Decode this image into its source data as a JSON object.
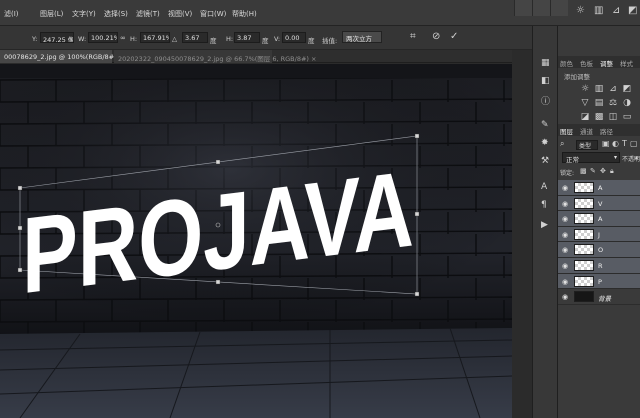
{
  "menu": {
    "items": [
      "滤(I)",
      "图层(L)",
      "文字(Y)",
      "选择(S)",
      "滤镜(T)",
      "视图(V)",
      "窗口(W)",
      "帮助(H)"
    ]
  },
  "options": {
    "y_label": "Y:",
    "y_value": "247.25 像3",
    "w_label": "W:",
    "w_value": "100.21%",
    "h_label": "H:",
    "h_value": "167.91%",
    "angle_label": "△",
    "angle_value": "3.67",
    "angle_unit": "度",
    "hskew_label": "H:",
    "hskew_value": "3.87",
    "hskew_unit": "度",
    "vskew_label": "V:",
    "vskew_value": "0.00",
    "vskew_unit": "度",
    "interp_label": "插值:",
    "interp_value": "两次立方",
    "cancel_icon": "⊘",
    "commit_icon": "✓"
  },
  "tabs": {
    "active": "00078629_2.jpg @ 100%(RGB/8#) ×",
    "inactive": "20202322_090450078629_2.jpg @ 66.7%(图层 6, RGB/8#) ×"
  },
  "canvas": {
    "text": "PROJAVA",
    "text_color": "#ffffff",
    "wall_color": "#1a1b20",
    "floor_color": "#2a2e37"
  },
  "panels": {
    "tabs_top": [
      "颜色",
      "色板",
      "调整",
      "样式"
    ],
    "adjust_title": "添加调整",
    "tabs_layers": [
      "图层",
      "通道",
      "路径"
    ],
    "kind_value": "类型",
    "blend_mode": "正常",
    "opacity_label": "不透明",
    "lock_label": "锁定:",
    "layers": [
      {
        "name": "A"
      },
      {
        "name": "V"
      },
      {
        "name": "A"
      },
      {
        "name": "J"
      },
      {
        "name": "O"
      },
      {
        "name": "R"
      },
      {
        "name": "P"
      },
      {
        "name": "背景"
      }
    ]
  }
}
